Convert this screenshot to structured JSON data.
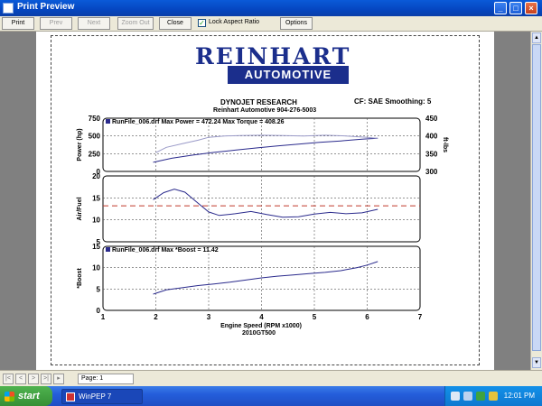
{
  "window": {
    "title": "Print Preview",
    "min": "_",
    "max": "□",
    "close": "×"
  },
  "toolbar": {
    "print": "Print",
    "prev": "Prev",
    "next": "Next",
    "zoom_out": "Zoom Out",
    "close": "Close",
    "lock_aspect": "Lock Aspect Ratio",
    "lock_checked": "✓",
    "options": "Options"
  },
  "report": {
    "logo_top": "REINHART",
    "logo_bottom": "AUTOMOTIVE",
    "header1": "DYNOJET RESEARCH",
    "header2": "Reinhart Automotive 904-276-5003",
    "cf": "CF: SAE  Smoothing: 5",
    "footer_title": "2010GT500"
  },
  "chart_data": [
    {
      "type": "line",
      "ylabel": "Power (hp)",
      "y2label": "ft-lbs",
      "legend": "RunFile_006.drf Max Power = 472.24   Max Torque = 408.26",
      "ylim": [
        0,
        750
      ],
      "yticks": [
        0,
        250,
        500,
        750
      ],
      "y2lim": [
        300,
        450
      ],
      "y2ticks": [
        300,
        350,
        400,
        450
      ],
      "xlim": [
        1,
        7
      ],
      "series": [
        {
          "name": "Power",
          "axis": "left",
          "color": "#2a2a8c",
          "x": [
            1.95,
            2.3,
            2.7,
            3.1,
            3.5,
            3.9,
            4.3,
            4.7,
            5.1,
            5.5,
            5.9,
            6.2
          ],
          "y": [
            128,
            185,
            230,
            268,
            300,
            330,
            358,
            384,
            410,
            430,
            455,
            468
          ]
        },
        {
          "name": "Torque",
          "axis": "right",
          "color": "#9a9ac8",
          "x": [
            2.0,
            2.2,
            2.5,
            2.8,
            3.0,
            3.3,
            3.6,
            4.0,
            4.4,
            4.8,
            5.2,
            5.6,
            6.0,
            6.2
          ],
          "y": [
            353,
            368,
            378,
            388,
            396,
            400,
            401,
            402,
            401,
            400,
            402,
            400,
            396,
            393
          ]
        }
      ]
    },
    {
      "type": "line",
      "ylabel": "Air/Fuel",
      "ylim": [
        5,
        20
      ],
      "yticks": [
        5,
        10,
        15,
        20
      ],
      "xlim": [
        1,
        7
      ],
      "reference_line": 13.2,
      "series": [
        {
          "name": "Air/Fuel",
          "color": "#2a2a8c",
          "x": [
            1.95,
            2.15,
            2.35,
            2.55,
            2.8,
            3.0,
            3.2,
            3.5,
            3.8,
            4.1,
            4.4,
            4.7,
            5.0,
            5.3,
            5.6,
            5.9,
            6.2
          ],
          "y": [
            14.6,
            16.2,
            17.0,
            16.3,
            13.8,
            11.8,
            11.0,
            11.4,
            11.9,
            11.2,
            10.6,
            10.7,
            11.3,
            11.7,
            11.4,
            11.6,
            12.4
          ]
        }
      ]
    },
    {
      "type": "line",
      "ylabel": "*Boost",
      "legend": "RunFile_006.drf Max *Boost = 11.42",
      "ylim": [
        0,
        15
      ],
      "yticks": [
        0,
        5,
        10,
        15
      ],
      "xlim": [
        1,
        7
      ],
      "xticks": [
        1,
        2,
        3,
        4,
        5,
        6,
        7
      ],
      "xlabel": "Engine Speed (RPM x1000)",
      "series": [
        {
          "name": "*Boost",
          "color": "#2a2a8c",
          "x": [
            1.95,
            2.2,
            2.5,
            2.8,
            3.1,
            3.4,
            3.7,
            4.0,
            4.3,
            4.6,
            4.9,
            5.2,
            5.5,
            5.8,
            6.0,
            6.2
          ],
          "y": [
            3.8,
            4.8,
            5.3,
            5.8,
            6.2,
            6.6,
            7.1,
            7.6,
            8.0,
            8.3,
            8.6,
            8.9,
            9.3,
            10.0,
            10.6,
            11.42
          ]
        }
      ]
    }
  ],
  "status": {
    "page": "Page: 1",
    "nav_first": "|<",
    "nav_prev": "<",
    "nav_next": ">",
    "nav_last": ">|",
    "nav_extra": "▸"
  },
  "taskbar": {
    "start": "start",
    "task": "WinPEP 7",
    "clock": "12:01 PM"
  }
}
